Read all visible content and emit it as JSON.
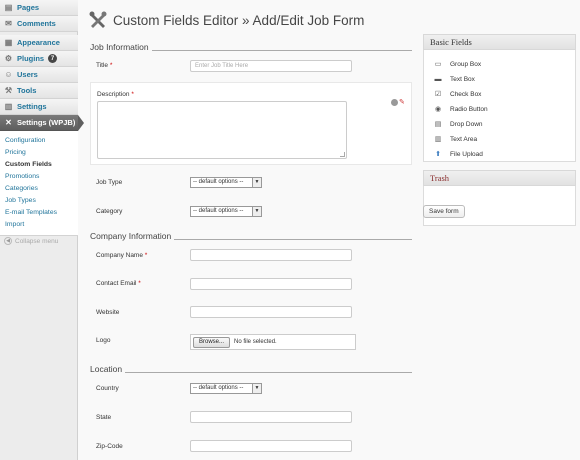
{
  "sidebar": {
    "menu": [
      {
        "label": "Pages",
        "icon": "pages-icon"
      },
      {
        "label": "Comments",
        "icon": "comments-icon"
      },
      {
        "label": "Appearance",
        "icon": "appearance-icon"
      },
      {
        "label": "Plugins",
        "icon": "plugins-icon",
        "badge": "7"
      },
      {
        "label": "Users",
        "icon": "users-icon"
      },
      {
        "label": "Tools",
        "icon": "tools-icon"
      },
      {
        "label": "Settings",
        "icon": "settings-icon"
      },
      {
        "label": "Settings (WPJB)",
        "icon": "wpjb-settings-icon",
        "active": true
      }
    ],
    "submenu": [
      "Configuration",
      "Pricing",
      "Custom Fields",
      "Promotions",
      "Categories",
      "Job Types",
      "E-mail Templates",
      "Import"
    ],
    "collapse_label": "Collapse menu"
  },
  "header": {
    "title": "Custom Fields Editor » Add/Edit Job Form"
  },
  "form": {
    "job_section": "Job Information",
    "title_label": "Title",
    "title_placeholder": "Enter Job Title Here",
    "description_label": "Description",
    "job_type_label": "Job Type",
    "category_label": "Category",
    "select_default": "-- default options --",
    "company_section": "Company Information",
    "company_name_label": "Company Name",
    "contact_email_label": "Contact Email",
    "website_label": "Website",
    "logo_label": "Logo",
    "browse_label": "Browse...",
    "no_file_label": "No file selected.",
    "location_section": "Location",
    "country_label": "Country",
    "state_label": "State",
    "zip_label": "Zip-Code",
    "required_marker": "*"
  },
  "panel": {
    "basic_title": "Basic Fields",
    "items": [
      {
        "label": "Group Box",
        "icon": "group-box-icon"
      },
      {
        "label": "Text Box",
        "icon": "text-box-icon"
      },
      {
        "label": "Check Box",
        "icon": "check-box-icon"
      },
      {
        "label": "Radio Button",
        "icon": "radio-button-icon"
      },
      {
        "label": "Drop Down",
        "icon": "drop-down-icon"
      },
      {
        "label": "Text Area",
        "icon": "text-area-icon"
      },
      {
        "label": "File Upload",
        "icon": "file-upload-icon"
      }
    ],
    "trash_title": "Trash",
    "save_label": "Save form"
  },
  "colors": {
    "link": "#21759b",
    "active_menu": "#5e5e5e",
    "required": "#cc0000",
    "trash_title": "#8a2f2f"
  }
}
